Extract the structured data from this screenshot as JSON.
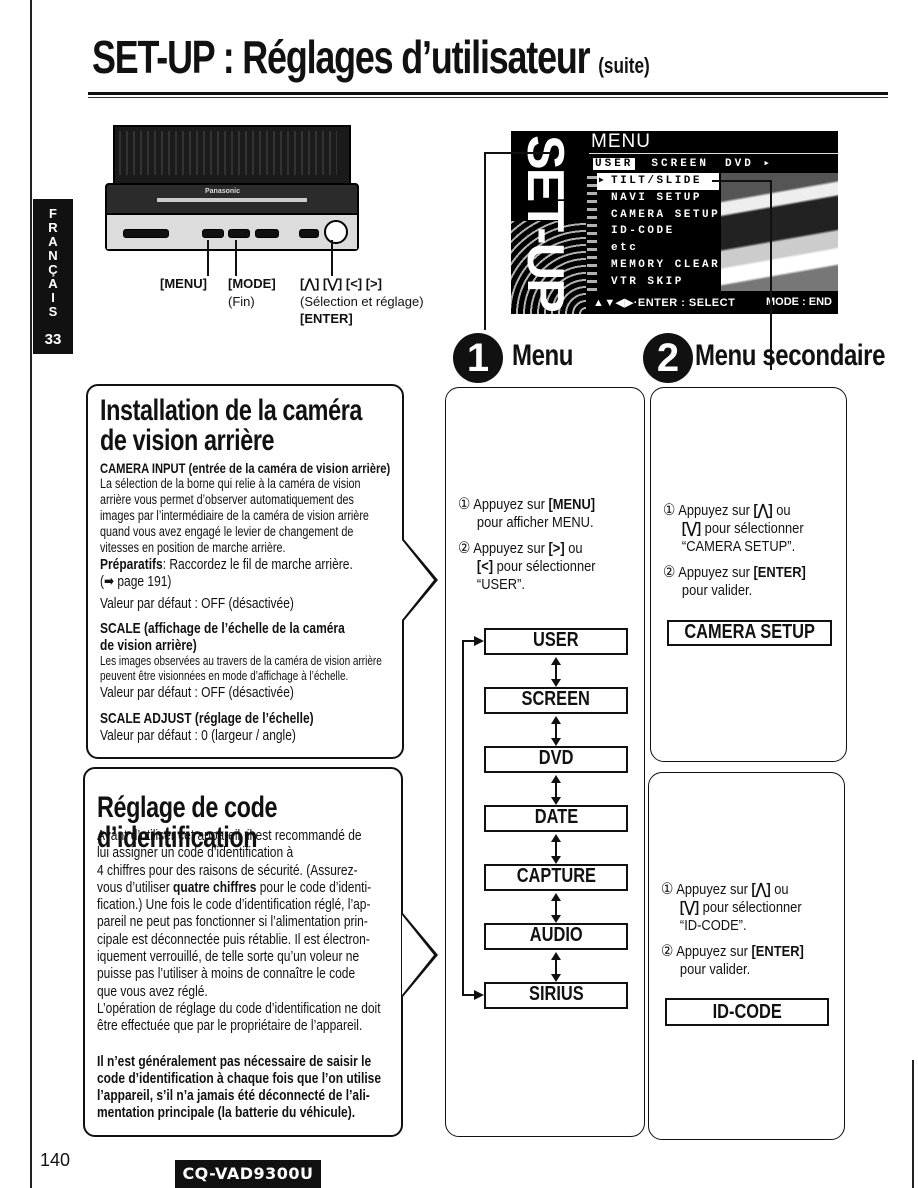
{
  "header": {
    "title": "SET-UP : Réglages d’utilisateur",
    "title_suffix": "(suite)"
  },
  "side_tab": {
    "letters": [
      "F",
      "R",
      "A",
      "N",
      "Ç",
      "A",
      "I",
      "S"
    ],
    "chapter_number": "33"
  },
  "device": {
    "brand": "Panasonic",
    "labels": {
      "menu": "[MENU]",
      "mode": "[MODE]",
      "mode_sub": "(Fin)",
      "arrows": "[⋀] [⋁] [<] [>]",
      "arrows_sub": "(Sélection et réglage)",
      "enter": "[ENTER]"
    }
  },
  "osd": {
    "side_text": "SET-UP",
    "title": "MENU",
    "tabs": [
      "USER",
      "SCREEN",
      "DVD ▸"
    ],
    "active_tab": "USER",
    "items": [
      "TILT/SLIDE",
      "NAVI SETUP",
      "CAMERA SETUP",
      "ID-CODE",
      "etc",
      "MEMORY CLEAR",
      "VTR SKIP"
    ],
    "selected_item": "TILT/SLIDE",
    "footer_left": "▲▼◀▶·ENTER : SELECT",
    "footer_right": "MODE : END"
  },
  "steps": {
    "step1": {
      "number": "1",
      "heading": "Menu"
    },
    "step2": {
      "number": "2",
      "heading": "Menu secondaire"
    }
  },
  "camera_section": {
    "title_line1": "Installation de la caméra",
    "title_line2": "de vision arrière",
    "camera_input_label": "CAMERA INPUT (entrée de la caméra de vision arrière)",
    "camera_input_lines": [
      "La sélection de la borne qui relie à la caméra de vision",
      "arrière vous permet d’observer automatiquement des",
      "images par l’intermédiaire de la caméra de vision arrière",
      "quand vous avez engagé le levier de changement de",
      "vitesses en position de marche arrière."
    ],
    "preparatifs_label": "Préparatifs",
    "preparatifs_text": ": Raccordez le fil de marche arrière.",
    "page_ref": "(➡ page 191)",
    "default1": "Valeur par défaut : OFF (désactivée)",
    "scale_label_line1": "SCALE (affichage de l’échelle de la caméra",
    "scale_label_line2": "de vision arrière)",
    "scale_lines": [
      "Les images observées au travers de la caméra de vision arrière",
      "peuvent être visionnées en mode d’affichage à l’échelle."
    ],
    "default2": "Valeur par défaut : OFF (désactivée)",
    "scale_adjust_label": "SCALE ADJUST (réglage de l’échelle)",
    "default3": "Valeur par défaut : 0 (largeur / angle)"
  },
  "id_section": {
    "title": "Réglage de code d’identification",
    "lines": [
      "Avant d’utiliser cet appareil, il est recommandé de",
      "lui assigner un code d’identification à",
      "4 chiffres pour des raisons de sécurité. (Assurez-"
    ],
    "line4_pre": "vous d’utiliser ",
    "line4_bold": "quatre chiffres",
    "line4_post": " pour le code d’identi-",
    "lines2": [
      "fication.) Une fois le code d’identification réglé, l’ap-",
      "pareil ne peut pas fonctionner si l’alimentation prin-",
      "cipale est déconnectée puis rétablie. Il est électron-",
      "iquement verrouillé, de telle sorte qu’un voleur ne",
      "puisse pas l’utiliser à moins de connaître le code",
      "que vous avez réglé.",
      "L’opération de réglage du code d’identification ne doit",
      "être effectuée que par le propriétaire de l’appareil."
    ],
    "note_lines": [
      "Il n’est généralement pas nécessaire de saisir le",
      "code d’identification à chaque fois que l’on utilise",
      "l’appareil, s’il n’a jamais été déconnecté de l’ali-",
      "mentation principale (la batterie du véhicule)."
    ]
  },
  "menu_column": {
    "instr1_num": "①",
    "instr1_a": "Appuyez sur ",
    "instr1_key": "[MENU]",
    "instr1_b": "pour afficher MENU.",
    "instr2_num": "②",
    "instr2_a": "Appuyez sur ",
    "instr2_key": "[>]",
    "instr2_a2": " ou",
    "instr2_key2": "[<]",
    "instr2_b": " pour sélectionner",
    "instr2_c": "“USER”.",
    "menu_items": [
      "USER",
      "SCREEN",
      "DVD",
      "DATE",
      "CAPTURE",
      "AUDIO",
      "SIRIUS"
    ]
  },
  "sub_camera": {
    "i1_num": "①",
    "i1_a": "Appuyez sur ",
    "i1_key": "[⋀]",
    "i1_a2": " ou",
    "i1_key2": "[⋁]",
    "i1_b": " pour sélectionner",
    "i1_c": "“CAMERA SETUP”.",
    "i2_num": "②",
    "i2_a": "Appuyez sur ",
    "i2_key": "[ENTER]",
    "i2_b": "pour valider.",
    "result": "CAMERA SETUP"
  },
  "sub_id": {
    "i1_num": "①",
    "i1_a": "Appuyez sur ",
    "i1_key": "[⋀]",
    "i1_a2": " ou",
    "i1_key2": "[⋁]",
    "i1_b": " pour sélectionner",
    "i1_c": "“ID-CODE”.",
    "i2_num": "②",
    "i2_a": "Appuyez sur ",
    "i2_key": "[ENTER]",
    "i2_b": "pour valider.",
    "result": "ID-CODE"
  },
  "footer": {
    "page_number": "140",
    "model": "CQ-VAD9300U"
  }
}
